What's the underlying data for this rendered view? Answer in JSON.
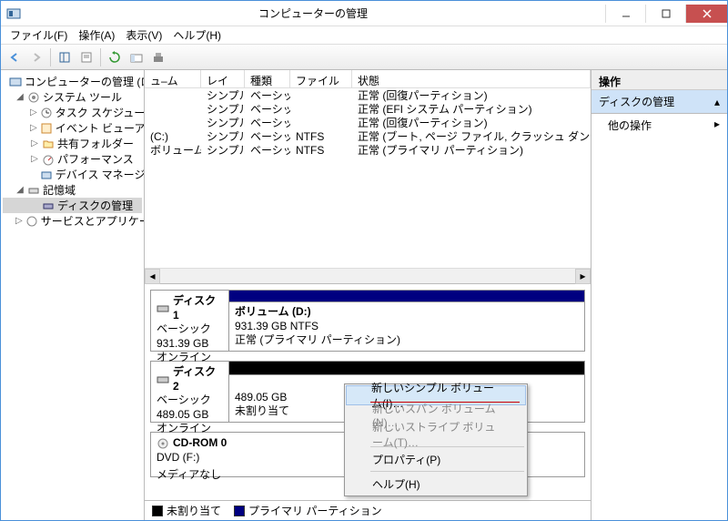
{
  "window": {
    "title": "コンピューターの管理"
  },
  "menu": {
    "file": "ファイル(F)",
    "action": "操作(A)",
    "view": "表示(V)",
    "help": "ヘルプ(H)"
  },
  "tree": {
    "root": "コンピューターの管理 (ローカル)",
    "systools": "システム ツール",
    "task": "タスク スケジューラ",
    "event": "イベント ビューアー",
    "shared": "共有フォルダー",
    "perf": "パフォーマンス",
    "devmgr": "デバイス マネージャー",
    "storage": "記憶域",
    "diskmgmt": "ディスクの管理",
    "services": "サービスとアプリケーション"
  },
  "vlist": {
    "cols": {
      "volume": "ュ–ム",
      "layout": "レイアウト",
      "type": "種類",
      "fs": "ファイル システム",
      "status": "状態"
    },
    "rows": [
      {
        "vol": "",
        "lay": "シンプル",
        "typ": "ベーシック",
        "fs": "",
        "st": "正常 (回復パーティション)"
      },
      {
        "vol": "",
        "lay": "シンプル",
        "typ": "ベーシック",
        "fs": "",
        "st": "正常 (EFI システム パーティション)"
      },
      {
        "vol": "",
        "lay": "シンプル",
        "typ": "ベーシック",
        "fs": "",
        "st": "正常 (回復パーティション)"
      },
      {
        "vol": "(C:)",
        "lay": "シンプル",
        "typ": "ベーシック",
        "fs": "NTFS",
        "st": "正常 (ブート, ページ ファイル, クラッシュ ダンプ, プライマリ パー…"
      },
      {
        "vol": "ボリューム (D:)",
        "lay": "シンプル",
        "typ": "ベーシック",
        "fs": "NTFS",
        "st": "正常 (プライマリ パーティション)"
      }
    ]
  },
  "disks": {
    "d1": {
      "name": "ディスク 1",
      "type": "ベーシック",
      "size": "931.39 GB",
      "status": "オンライン",
      "vol": {
        "name": "ボリューム  (D:)",
        "size": "931.39 GB NTFS",
        "status": "正常 (プライマリ パーティション)"
      }
    },
    "d2": {
      "name": "ディスク 2",
      "type": "ベーシック",
      "size": "489.05 GB",
      "status": "オンライン",
      "vol": {
        "size": "489.05 GB",
        "status": "未割り当て"
      }
    },
    "cd": {
      "name": "CD-ROM 0",
      "type": "DVD (F:)",
      "status": "メディアなし"
    }
  },
  "legend": {
    "unalloc": "未割り当て",
    "primary": "プライマリ パーティション"
  },
  "right": {
    "head": "操作",
    "sel": "ディスクの管理",
    "other": "他の操作"
  },
  "ctx": {
    "simple": "新しいシンプル ボリューム(I)…",
    "span": "新しいスパン ボリューム(N)…",
    "stripe": "新しいストライプ ボリューム(T)…",
    "prop": "プロパティ(P)",
    "help": "ヘルプ(H)"
  }
}
